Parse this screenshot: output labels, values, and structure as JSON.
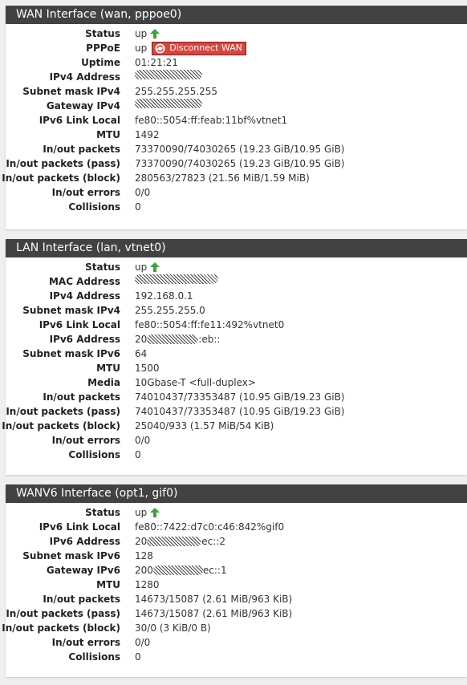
{
  "colors": {
    "header_bg": "#424242",
    "arrow_up": "#3ba43b",
    "disconnect_bg": "#d9443f"
  },
  "wan": {
    "title": "WAN Interface (wan, pppoe0)",
    "labels": {
      "status": "Status",
      "pppoe": "PPPoE",
      "uptime": "Uptime",
      "ipv4": "IPv4 Address",
      "mask4": "Subnet mask IPv4",
      "gw4": "Gateway IPv4",
      "ll6": "IPv6 Link Local",
      "mtu": "MTU",
      "inout": "In/out packets",
      "pass": "In/out packets (pass)",
      "block": "In/out packets (block)",
      "errors": "In/out errors",
      "coll": "Collisions"
    },
    "values": {
      "status": "up",
      "pppoe": "up",
      "disconnect": "Disconnect WAN",
      "uptime": "01:21:21",
      "mask4": "255.255.255.255",
      "ll6": "fe80::5054:ff:feab:11bf%vtnet1",
      "mtu": "1492",
      "inout": "73370090/74030265 (19.23 GiB/10.95 GiB)",
      "pass": "73370090/74030265 (19.23 GiB/10.95 GiB)",
      "block": "280563/27823 (21.56 MiB/1.59 MiB)",
      "errors": "0/0",
      "coll": "0"
    }
  },
  "lan": {
    "title": "LAN Interface (lan, vtnet0)",
    "labels": {
      "status": "Status",
      "mac": "MAC Address",
      "ipv4": "IPv4 Address",
      "mask4": "Subnet mask IPv4",
      "ll6": "IPv6 Link Local",
      "ipv6": "IPv6 Address",
      "mask6": "Subnet mask IPv6",
      "mtu": "MTU",
      "media": "Media",
      "inout": "In/out packets",
      "pass": "In/out packets (pass)",
      "block": "In/out packets (block)",
      "errors": "In/out errors",
      "coll": "Collisions"
    },
    "values": {
      "status": "up",
      "ipv4": "192.168.0.1",
      "mask4": "255.255.255.0",
      "ll6": "fe80::5054:ff:fe11:492%vtnet0",
      "ipv6_pre": "20",
      "ipv6_suf": ":eb::",
      "mask6": "64",
      "mtu": "1500",
      "media": "10Gbase-T <full-duplex>",
      "inout": "74010437/73353487 (10.95 GiB/19.23 GiB)",
      "pass": "74010437/73353487 (10.95 GiB/19.23 GiB)",
      "block": "25040/933 (1.57 MiB/54 KiB)",
      "errors": "0/0",
      "coll": "0"
    }
  },
  "wanv6": {
    "title": "WANV6 Interface (opt1, gif0)",
    "labels": {
      "status": "Status",
      "ll6": "IPv6 Link Local",
      "ipv6": "IPv6 Address",
      "mask6": "Subnet mask IPv6",
      "gw6": "Gateway IPv6",
      "mtu": "MTU",
      "inout": "In/out packets",
      "pass": "In/out packets (pass)",
      "block": "In/out packets (block)",
      "errors": "In/out errors",
      "coll": "Collisions"
    },
    "values": {
      "status": "up",
      "ll6": "fe80::7422:d7c0:c46:842%gif0",
      "ipv6_pre": "20",
      "ipv6_suf": "ec::2",
      "mask6": "128",
      "gw6_pre": "200",
      "gw6_suf": "ec::1",
      "mtu": "1280",
      "inout": "14673/15087 (2.61 MiB/963 KiB)",
      "pass": "14673/15087 (2.61 MiB/963 KiB)",
      "block": "30/0 (3 KiB/0 B)",
      "errors": "0/0",
      "coll": "0"
    }
  }
}
